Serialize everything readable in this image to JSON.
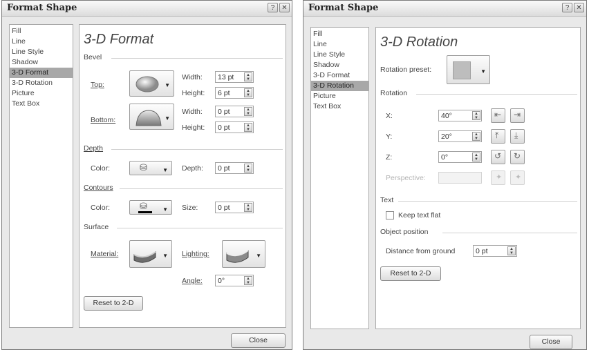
{
  "dialog1": {
    "title": "Format Shape",
    "help_glyph": "?",
    "close_glyph": "✕",
    "nav": [
      "Fill",
      "Line",
      "Line Style",
      "Shadow",
      "3-D Format",
      "3-D Rotation",
      "Picture",
      "Text Box"
    ],
    "selected_nav": "3-D Format",
    "heading": "3-D Format",
    "bevel": {
      "section": "Bevel",
      "top_label": "Top:",
      "bottom_label": "Bottom:",
      "width_label": "Width:",
      "height_label": "Height:",
      "top_width": "13 pt",
      "top_height": "6 pt",
      "bottom_width": "0 pt",
      "bottom_height": "0 pt"
    },
    "depth": {
      "section": "Depth",
      "color_label": "Color:",
      "depth_label": "Depth:",
      "depth_value": "0 pt"
    },
    "contours": {
      "section": "Contours",
      "color_label": "Color:",
      "size_label": "Size:",
      "size_value": "0 pt"
    },
    "surface": {
      "section": "Surface",
      "material_label": "Material:",
      "lighting_label": "Lighting:",
      "angle_label": "Angle:",
      "angle_value": "0°"
    },
    "reset_label": "Reset to 2-D",
    "close_label": "Close"
  },
  "dialog2": {
    "title": "Format Shape",
    "help_glyph": "?",
    "close_glyph": "✕",
    "nav": [
      "Fill",
      "Line",
      "Line Style",
      "Shadow",
      "3-D Format",
      "3-D Rotation",
      "Picture",
      "Text Box"
    ],
    "selected_nav": "3-D Rotation",
    "heading": "3-D Rotation",
    "preset_label": "Rotation preset:",
    "rotation": {
      "section": "Rotation",
      "x_label": "X:",
      "x_value": "40°",
      "y_label": "Y:",
      "y_value": "20°",
      "z_label": "Z:",
      "z_value": "0°",
      "perspective_label": "Perspective:",
      "perspective_value": ""
    },
    "text": {
      "section": "Text",
      "keep_flat_label": "Keep text flat",
      "keep_flat_checked": false
    },
    "object_position": {
      "section": "Object position",
      "distance_label": "Distance from ground",
      "distance_value": "0 pt"
    },
    "reset_label": "Reset to 2-D",
    "close_label": "Close"
  }
}
